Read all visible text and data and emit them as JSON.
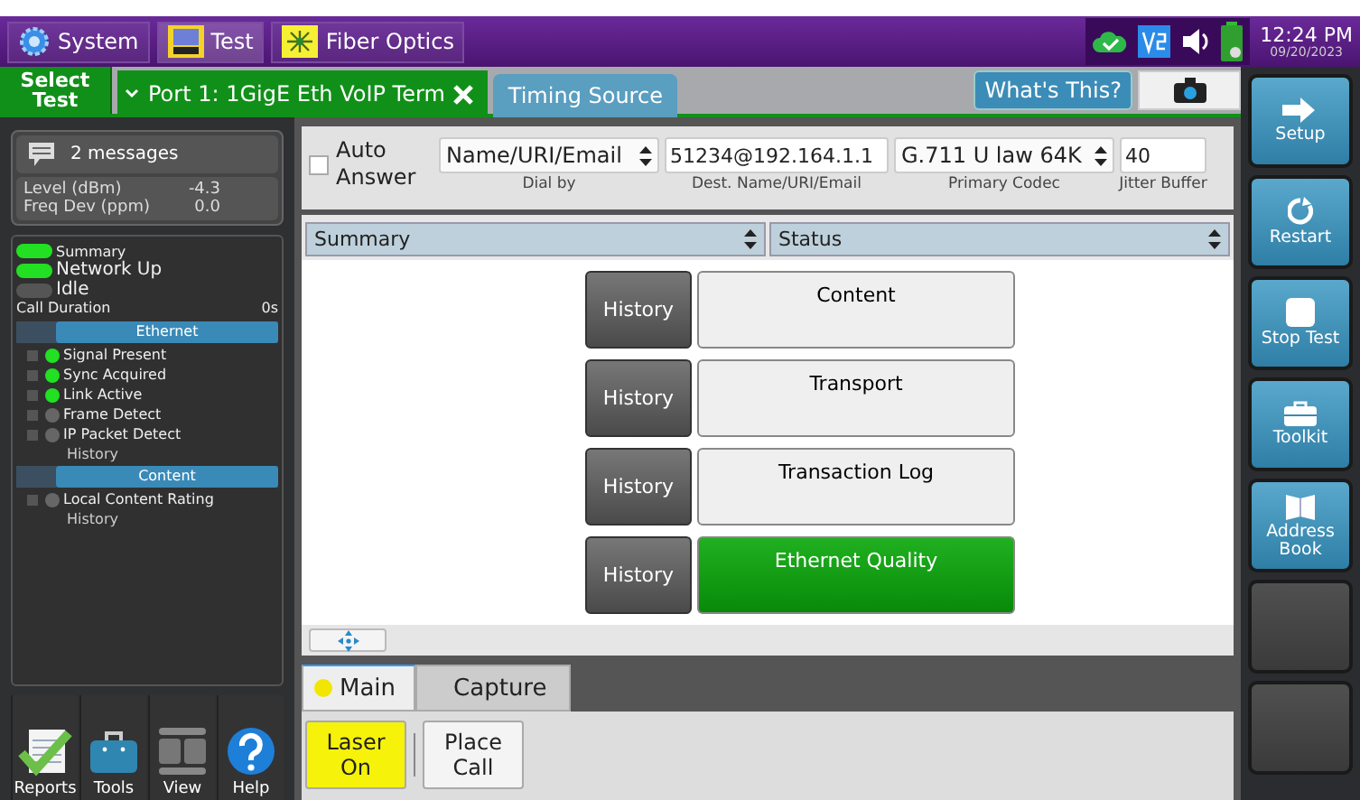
{
  "top_bar": {
    "apps": [
      {
        "label": "System",
        "kind": "gear",
        "selected": false
      },
      {
        "label": "Test",
        "kind": "bert",
        "selected": true
      },
      {
        "label": "Fiber Optics",
        "kind": "laser",
        "selected": false
      }
    ],
    "time": "12:24 PM",
    "date": "09/20/2023"
  },
  "tab_row": {
    "select_test": "Select Test",
    "tabs": [
      {
        "label": "Port 1: 1GigE Eth VoIP Term",
        "selected": true
      },
      {
        "label": "Timing Source",
        "selected": false
      }
    ],
    "whats_this": "What's This?"
  },
  "left_panel": {
    "messages": "2 messages",
    "readings": [
      {
        "label": "Level (dBm)",
        "value": "-4.3"
      },
      {
        "label": "Freq Dev (ppm)",
        "value": "0.0"
      }
    ],
    "indicators": [
      {
        "label": "Summary",
        "on": true
      },
      {
        "label": "Network Up",
        "on": true
      },
      {
        "label": "Idle",
        "on": false
      }
    ],
    "call_duration": {
      "label": "Call Duration",
      "value": "0s"
    },
    "groups": [
      {
        "title": "Ethernet",
        "items": [
          {
            "label": "Signal Present",
            "on": true
          },
          {
            "label": "Sync Acquired",
            "on": true
          },
          {
            "label": "Link Active",
            "on": true
          },
          {
            "label": "Frame Detect",
            "on": false
          },
          {
            "label": "IP Packet Detect",
            "on": false
          }
        ],
        "history": "History"
      },
      {
        "title": "Content",
        "items": [
          {
            "label": "Local Content Rating",
            "on": false
          }
        ],
        "history": "History"
      }
    ],
    "tools": [
      {
        "label": "Reports",
        "kind": "reports"
      },
      {
        "label": "Tools",
        "kind": "tools"
      },
      {
        "label": "View",
        "kind": "view"
      },
      {
        "label": "Help",
        "kind": "help"
      }
    ]
  },
  "settings": {
    "auto_answer": {
      "label": "Auto Answer",
      "checked": false
    },
    "fields": [
      {
        "kind": "select",
        "value": "Name/URI/Email",
        "caption": "Dial by"
      },
      {
        "kind": "text",
        "value": "51234@192.164.1.1",
        "caption": "Dest. Name/URI/Email"
      },
      {
        "kind": "select",
        "value": "G.711 U law 64K",
        "caption": "Primary Codec"
      },
      {
        "kind": "text",
        "value": "40",
        "caption": "Jitter Buffer"
      }
    ]
  },
  "view_selectors": [
    "Summary",
    "Status"
  ],
  "results": [
    {
      "history": "History",
      "label": "Content",
      "kind": "neutral"
    },
    {
      "history": "History",
      "label": "Transport",
      "kind": "neutral"
    },
    {
      "history": "History",
      "label": "Transaction Log",
      "kind": "neutral"
    },
    {
      "history": "History",
      "label": "Ethernet Quality",
      "kind": "pass"
    }
  ],
  "bottom_tabs": [
    {
      "label": "Main",
      "selected": true,
      "color": "#f2e600"
    },
    {
      "label": "Capture",
      "selected": false
    }
  ],
  "actions": [
    {
      "label": "Laser On",
      "on": true
    },
    {
      "label": "Place Call",
      "on": false
    }
  ],
  "side_buttons": [
    {
      "label": "Setup",
      "kind": "arrow"
    },
    {
      "label": "Restart",
      "kind": "restart"
    },
    {
      "label": "Stop Test",
      "kind": "stop"
    },
    {
      "label": "Toolkit",
      "kind": "toolkit"
    },
    {
      "label": "Address Book",
      "kind": "book"
    },
    {
      "kind": "blank"
    },
    {
      "kind": "blank"
    }
  ]
}
